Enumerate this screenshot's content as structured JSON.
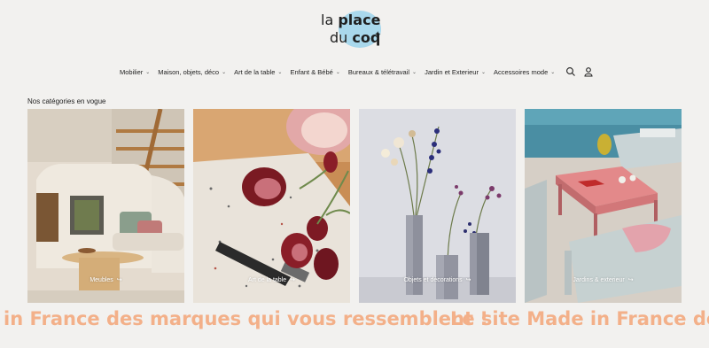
{
  "logo": {
    "line1_a": "la",
    "line1_b": "place",
    "line2_a": "du",
    "line2_b": "coq"
  },
  "nav": {
    "items": [
      {
        "label": "Mobilier"
      },
      {
        "label": "Maison, objets, déco"
      },
      {
        "label": "Art de la table"
      },
      {
        "label": "Enfant & Bébé"
      },
      {
        "label": "Bureaux & télétravail"
      },
      {
        "label": "Jardin et Exterieur"
      },
      {
        "label": "Accessoires mode"
      }
    ],
    "icons": [
      "search-icon",
      "user-icon"
    ]
  },
  "section": {
    "title": "Nos catégories en vogue"
  },
  "categories": [
    {
      "label": "Meubles"
    },
    {
      "label": "Art de la table"
    },
    {
      "label": "Objets et décorations"
    },
    {
      "label": "Jardins & exterieur"
    }
  ],
  "marquee": {
    "part1": "in France des marques qui vous ressemblent !",
    "part2": "Le site Made in France des m"
  },
  "colors": {
    "background": "#f2f1ef",
    "marquee_text": "#f3b089",
    "logo_blob": "#a9d8ec"
  }
}
